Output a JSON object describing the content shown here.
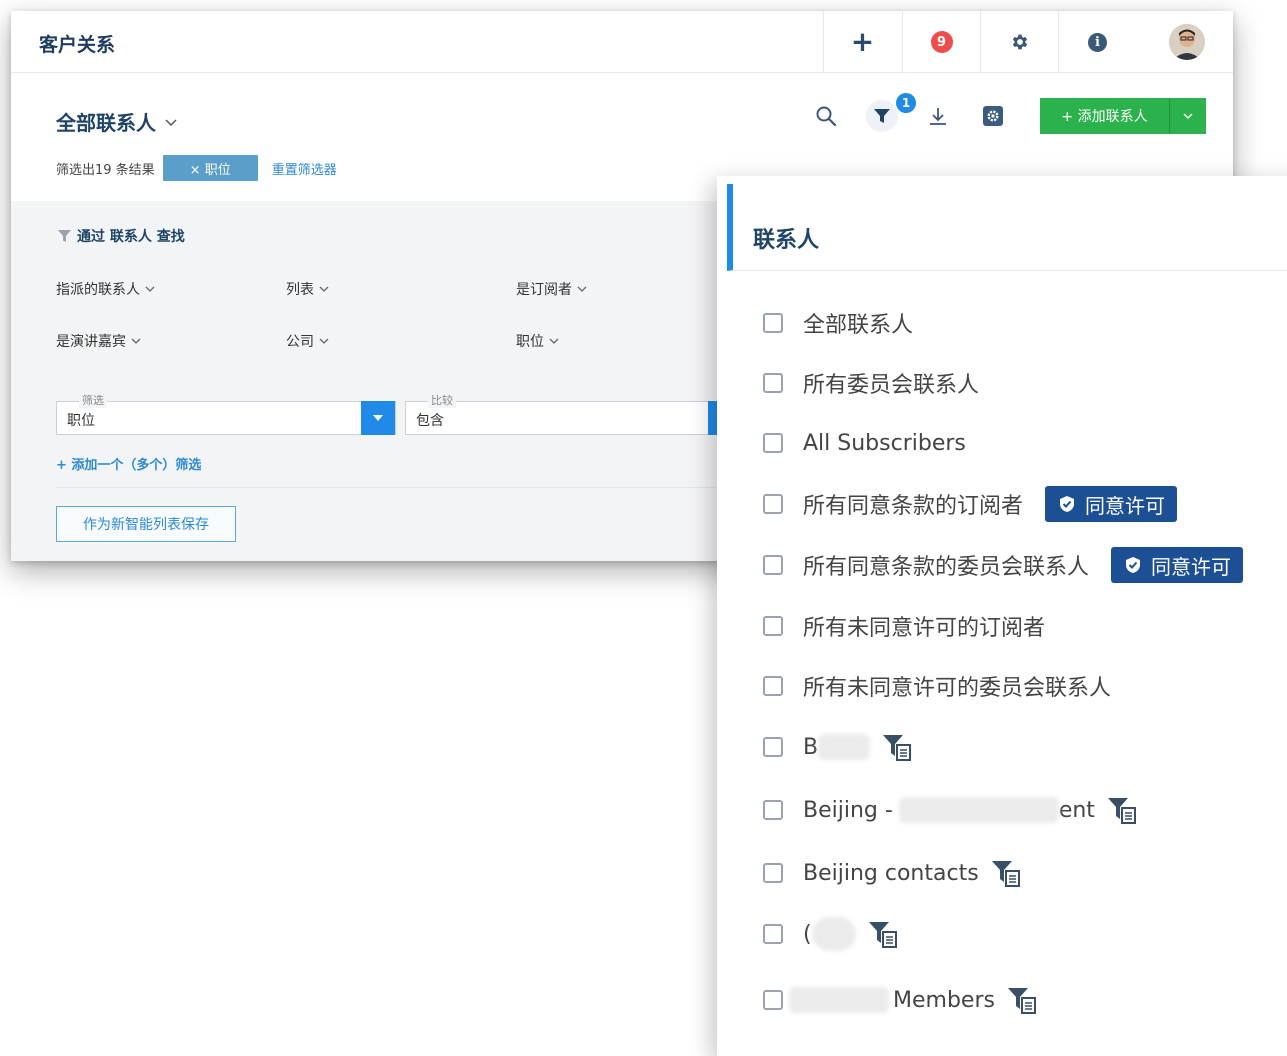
{
  "topbar": {
    "title": "客户关系",
    "notifications_count": "9"
  },
  "list": {
    "title": "全部联系人",
    "result_count": "筛选出19 条结果",
    "active_filter_chip": "× 职位",
    "reset_filters": "重置筛选器"
  },
  "toolbar": {
    "active_filter_count": "1",
    "add_contact_label": "+ 添加联系人"
  },
  "filter_panel": {
    "heading": "通过 联系人 查找",
    "criteria": [
      "指派的联系人",
      "列表",
      "是订阅者",
      "是演讲嘉宾",
      "公司",
      "职位"
    ],
    "filter_field": {
      "legend": "筛选",
      "value": "职位"
    },
    "compare_field": {
      "legend": "比较",
      "value": "包含"
    },
    "add_filter_link": "+ 添加一个（多个）筛选",
    "save_smart_list": "作为新智能列表保存"
  },
  "dropdown": {
    "title": "联系人",
    "consent_badge_label": "同意许可",
    "items": [
      {
        "label": "全部联系人"
      },
      {
        "label": "所有委员会联系人"
      },
      {
        "label": "All Subscribers"
      },
      {
        "label": "所有同意条款的订阅者"
      },
      {
        "label": "所有同意条款的委员会联系人"
      },
      {
        "label": "所有未同意许可的订阅者"
      },
      {
        "label": "所有未同意许可的委员会联系人"
      },
      {
        "label": "B"
      },
      {
        "label": "Beijing -",
        "suffix": "ent"
      },
      {
        "label": "Beijing contacts"
      },
      {
        "label": "("
      },
      {
        "label": "Members"
      }
    ]
  },
  "colors": {
    "brand_navy": "#1f4466",
    "accent_blue": "#1f8ae8",
    "success_green": "#2bb24c",
    "notif_red": "#ef4c4c",
    "consent_badge": "#1c4f93"
  }
}
